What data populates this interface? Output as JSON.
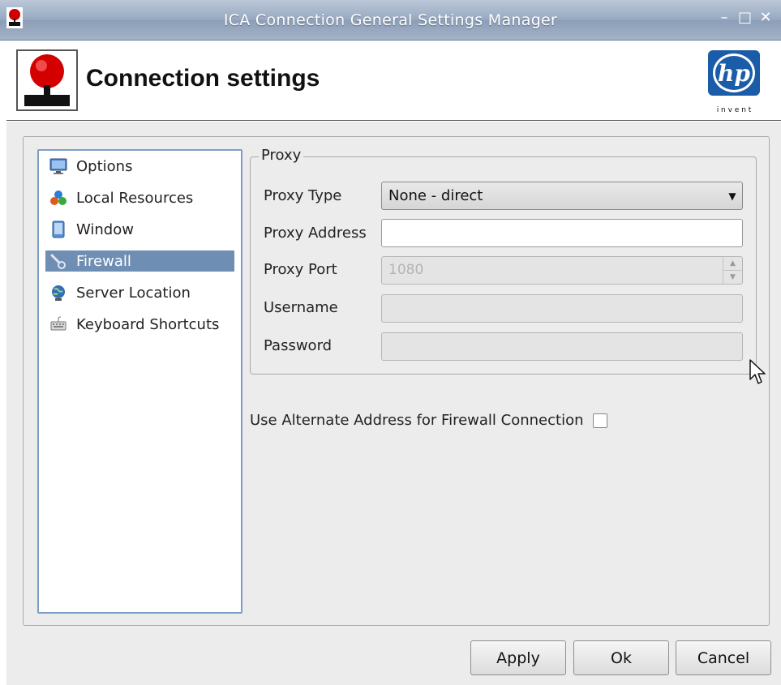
{
  "window": {
    "title": "ICA Connection General Settings Manager",
    "min_glyph": "–",
    "max_glyph": "□",
    "close_glyph": "✕"
  },
  "header": {
    "title": "Connection settings",
    "logo_text": "hp",
    "logo_tagline": "i n v e n t"
  },
  "sidebar": {
    "items": [
      {
        "label": "Options",
        "icon": "monitor-icon"
      },
      {
        "label": "Local Resources",
        "icon": "local-resources-icon"
      },
      {
        "label": "Window",
        "icon": "window-icon"
      },
      {
        "label": "Firewall",
        "icon": "firewall-icon",
        "selected": true
      },
      {
        "label": "Server Location",
        "icon": "globe-icon"
      },
      {
        "label": "Keyboard Shortcuts",
        "icon": "keyboard-icon"
      }
    ]
  },
  "proxy": {
    "legend": "Proxy",
    "type_label": "Proxy Type",
    "type_value": "None - direct",
    "address_label": "Proxy Address",
    "address_value": "",
    "port_label": "Proxy Port",
    "port_value": "1080",
    "username_label": "Username",
    "username_value": "",
    "password_label": "Password",
    "password_value": ""
  },
  "alternate_address": {
    "label": "Use Alternate Address for Firewall Connection",
    "checked": false
  },
  "buttons": {
    "apply": "Apply",
    "ok": "Ok",
    "cancel": "Cancel"
  },
  "colors": {
    "selection": "#6f8eb3",
    "list_border": "#7d9fc7",
    "titlebar": "#97a8c0"
  }
}
